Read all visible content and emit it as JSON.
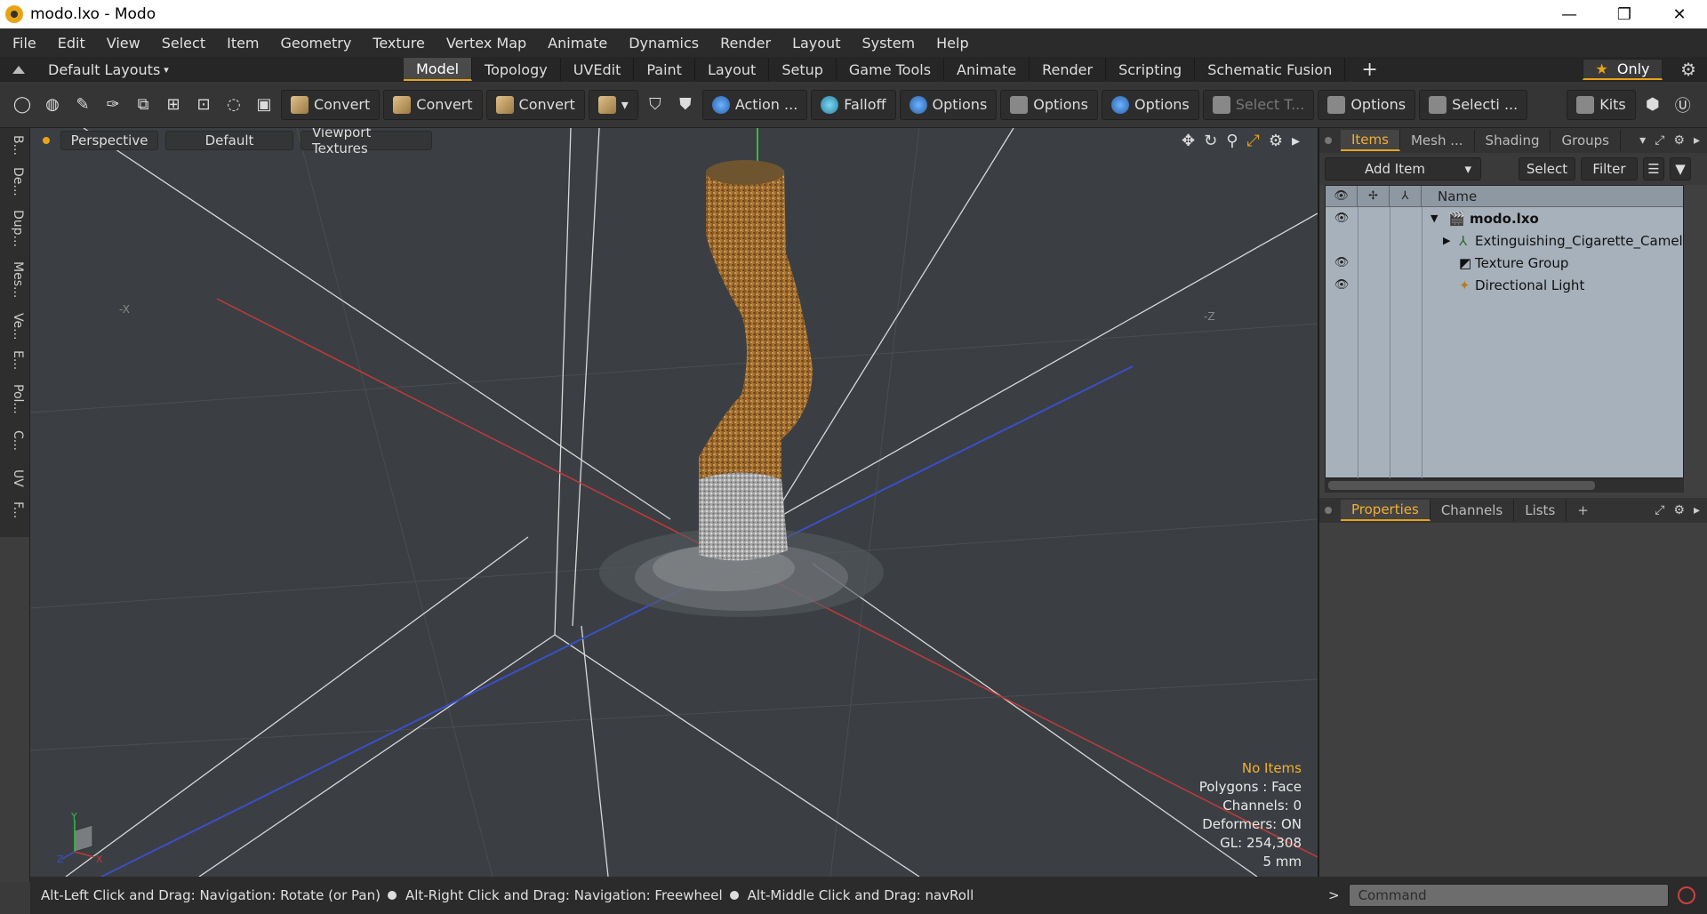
{
  "window": {
    "title": "modo.lxo - Modo",
    "controls": [
      "—",
      "❐",
      "✕"
    ]
  },
  "menu": [
    "File",
    "Edit",
    "View",
    "Select",
    "Item",
    "Geometry",
    "Texture",
    "Vertex Map",
    "Animate",
    "Dynamics",
    "Render",
    "Layout",
    "System",
    "Help"
  ],
  "layouts": {
    "label": "Default Layouts",
    "caret": "▾"
  },
  "tabs": [
    "Model",
    "Topology",
    "UVEdit",
    "Paint",
    "Layout",
    "Setup",
    "Game Tools",
    "Animate",
    "Render",
    "Scripting",
    "Schematic Fusion"
  ],
  "active_tab": "Model",
  "plus_label": "+",
  "only_btn": {
    "star": "★",
    "label": "Only"
  },
  "toolbar": {
    "convert1": "Convert",
    "convert2": "Convert",
    "convert3": "Convert",
    "action": "Action",
    "action_more": "...",
    "falloff": "Falloff",
    "options1": "Options",
    "options2": "Options",
    "options3": "Options",
    "select_t": "Select T...",
    "options4": "Options",
    "selecti": "Selecti ...",
    "kits": "Kits"
  },
  "left_tabs": [
    "B...",
    "De...",
    "Dup...",
    "Mes...",
    "Ve...",
    "E...",
    "Pol...",
    "C...",
    "UV",
    "F..."
  ],
  "viewport": {
    "perspective": "Perspective",
    "default": "Default",
    "textures": "Viewport Textures",
    "label_x": "-X",
    "label_z": "-Z",
    "info": {
      "no_items": "No Items",
      "polygons": "Polygons : Face",
      "channels": "Channels: 0",
      "deformers": "Deformers: ON",
      "gl": "GL: 254,308",
      "scale": "5 mm"
    },
    "gizmo": {
      "y": "Y",
      "z": "Z",
      "x": "X"
    }
  },
  "status": {
    "s1": "Alt-Left Click and Drag: Navigation: Rotate (or Pan)",
    "s2": "Alt-Right Click and Drag: Navigation: Freewheel",
    "s3": "Alt-Middle Click and Drag: navRoll"
  },
  "items_panel": {
    "tabs": [
      "Items",
      "Mesh ...",
      "Shading",
      "Groups"
    ],
    "add_item": "Add Item",
    "select": "Select",
    "filter": "Filter",
    "name_header": "Name",
    "rows": [
      {
        "label": "modo.lxo",
        "bold": true
      },
      {
        "label": "Extinguishing_Cigarette_Camel"
      },
      {
        "label": "Texture Group"
      },
      {
        "label": "Directional Light"
      }
    ]
  },
  "props_panel": {
    "tabs": [
      "Properties",
      "Channels",
      "Lists"
    ],
    "plus": "+"
  },
  "command": {
    "prompt": ">",
    "placeholder": "Command"
  },
  "colors": {
    "accent": "#e8a317",
    "viewport_bg": "#3b3f43",
    "items_bg": "#a7b1bb"
  }
}
